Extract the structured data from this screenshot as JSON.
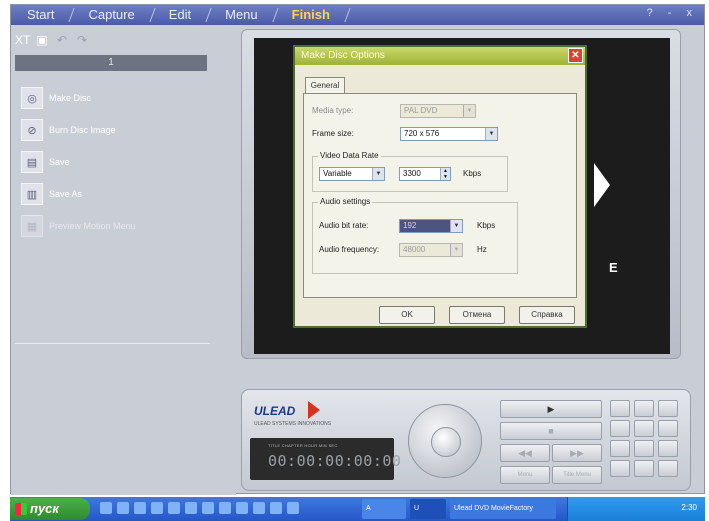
{
  "menu": {
    "items": [
      "Start",
      "Capture",
      "Edit",
      "Menu",
      "Finish"
    ],
    "active": "Finish",
    "window_controls": "? - x"
  },
  "left_panel": {
    "page_indicator": "1",
    "actions": [
      {
        "label": "Make Disc",
        "icon": "disc-icon",
        "enabled": true
      },
      {
        "label": "Burn Disc Image",
        "icon": "burn-icon",
        "enabled": true
      },
      {
        "label": "Save",
        "icon": "save-icon",
        "enabled": true
      },
      {
        "label": "Save As",
        "icon": "save-as-icon",
        "enabled": true
      },
      {
        "label": "Preview Motion Menu",
        "icon": "preview-icon",
        "enabled": false
      }
    ]
  },
  "preview": {
    "overlay_letter": "E"
  },
  "dialog": {
    "title": "Make Disc Options",
    "tab": "General",
    "media_type": {
      "label": "Media type:",
      "value": "PAL DVD"
    },
    "frame_size": {
      "label": "Frame size:",
      "value": "720 x 576"
    },
    "video_data_rate": {
      "title": "Video Data Rate",
      "mode": "Variable",
      "value": "3300",
      "unit": "Kbps"
    },
    "audio_settings": {
      "title": "Audio settings",
      "bit_rate": {
        "label": "Audio bit rate:",
        "value": "192",
        "unit": "Kbps"
      },
      "frequency": {
        "label": "Audio frequency:",
        "value": "48000",
        "unit": "Hz"
      }
    },
    "buttons": {
      "ok": "OK",
      "cancel": "Отмена",
      "help": "Справка"
    }
  },
  "control_panel": {
    "brand": "ULEAD",
    "brand_sub": "ULEAD SYSTEMS INNOVATIONS",
    "timecode_labels": "TITLE CHAPTER HOUR MIN SEC",
    "timecode": "00:00:00:00:00",
    "play_glyph": "▶",
    "stop_glyph": "■",
    "prev_glyph": "◀◀",
    "next_glyph": "▶▶",
    "btn_menu": "Menu",
    "btn_home": "Title Menu"
  },
  "taskbar": {
    "start_label": "пуск",
    "tasks": [
      "A",
      "U",
      "Ulead DVD MovieFactory"
    ],
    "clock": "2:30"
  }
}
